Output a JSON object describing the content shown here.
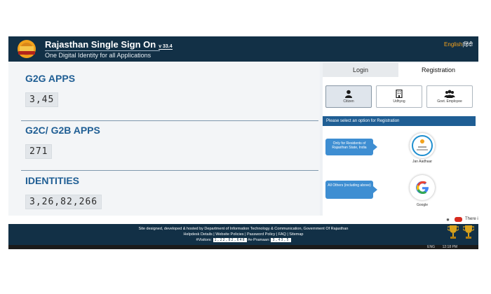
{
  "header": {
    "title": "Rajasthan Single Sign On",
    "version": "v 33.4",
    "tagline": "One Digital Identity for all Applications",
    "lang_english": "English",
    "lang_separator": "|",
    "lang_hindi": "हिंदी"
  },
  "stats": [
    {
      "title": "G2G APPS",
      "value": "3,45"
    },
    {
      "title": "G2C/ G2B APPS",
      "value": "271"
    },
    {
      "title": "IDENTITIES",
      "value": "3,26,82,266"
    }
  ],
  "tabs": {
    "login": "Login",
    "registration": "Registration"
  },
  "registration": {
    "options": [
      {
        "label": "Citizen",
        "icon": "person-icon"
      },
      {
        "label": "Udhyog",
        "icon": "building-icon"
      },
      {
        "label": "Govt. Employee",
        "icon": "group-icon"
      }
    ],
    "prompt": "Please select an option for Registration",
    "jan_callout": "Only for Residents of Rajasthan State, India",
    "jan_label": "Jan Aadhaar",
    "google_callout": "All Others (including above)",
    "google_label": "Google"
  },
  "notice": {
    "text": "There i"
  },
  "footer": {
    "line1": "Site designed, developed & hosted by Department of Information Technology & Communication, Government Of Rajasthan",
    "line2": "Helpdesk Details | Website Policies | Password Policy | FAQ | Sitemap",
    "visitors_label": "#Visitors:",
    "visitors_value": "1,22,82,648",
    "epramaan_label": "#e-Pramaan:",
    "epramaan_value": "3,43,5"
  },
  "taskbar": {
    "language": "ENG",
    "time": "12:18 PM"
  },
  "colors": {
    "navy": "#123046",
    "accent_blue": "#1f5e94",
    "orange": "#f6a31c",
    "callout_blue": "#3e8ed2"
  }
}
